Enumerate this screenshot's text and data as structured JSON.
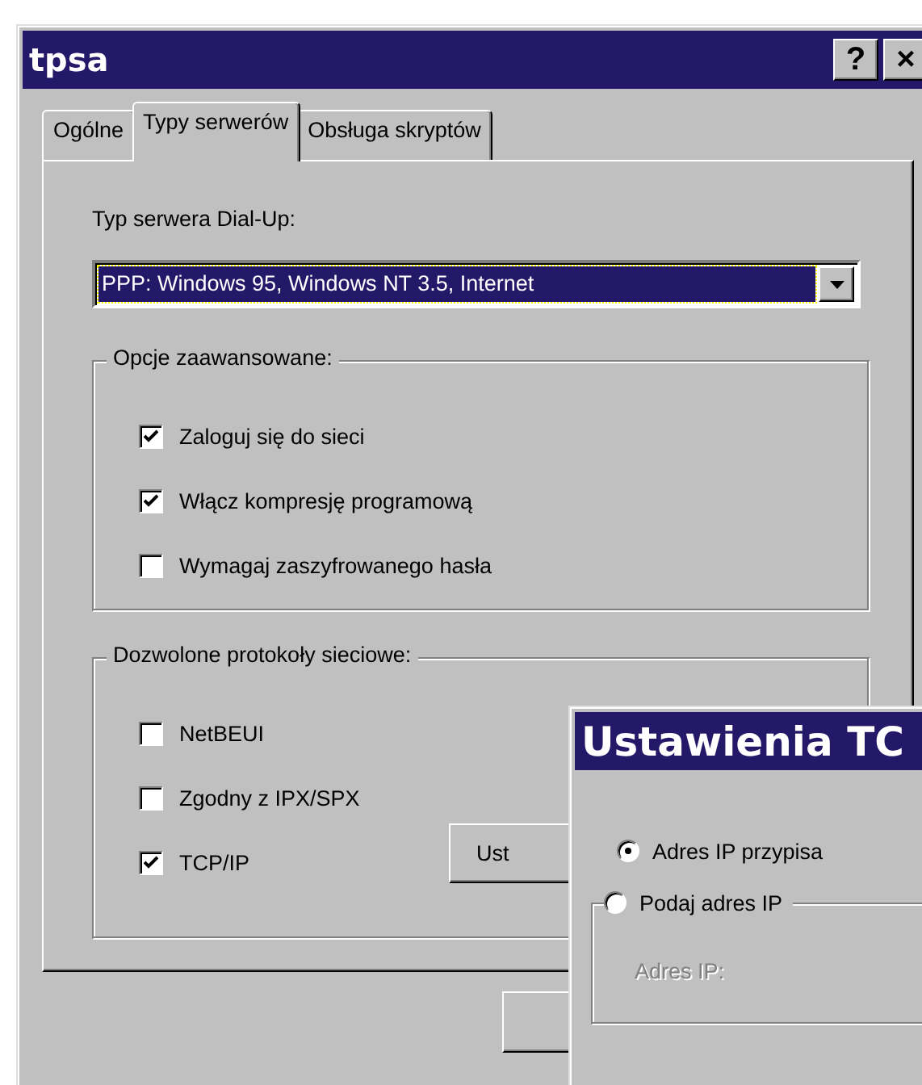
{
  "window": {
    "title": "tpsa",
    "help_button": "?",
    "close_button": "×"
  },
  "tabs": [
    {
      "label": "Ogólne",
      "selected": false
    },
    {
      "label": "Typy serwerów",
      "selected": true
    },
    {
      "label": "Obsługa skryptów",
      "selected": false
    }
  ],
  "server_type": {
    "label": "Typ serwera Dial-Up:",
    "value": "PPP: Windows 95, Windows NT 3.5, Internet"
  },
  "advanced_options": {
    "title": "Opcje zaawansowane:",
    "options": [
      {
        "label": "Zaloguj się do sieci",
        "checked": true
      },
      {
        "label": "Włącz kompresję programową",
        "checked": true
      },
      {
        "label": "Wymagaj zaszyfrowanego hasła",
        "checked": false
      }
    ]
  },
  "protocols": {
    "title": "Dozwolone protokoły sieciowe:",
    "options": [
      {
        "label": "NetBEUI",
        "checked": false
      },
      {
        "label": "Zgodny z IPX/SPX",
        "checked": false
      },
      {
        "label": "TCP/IP",
        "checked": true
      }
    ],
    "settings_button": "Ust"
  },
  "tcp_dialog": {
    "title": "Ustawienia TC",
    "ip_mode": [
      {
        "label": "Adres IP przypisa",
        "selected": true
      },
      {
        "label": "Podaj adres IP",
        "selected": false
      }
    ],
    "ip_address": {
      "label": "Adres IP:",
      "disabled": true
    }
  }
}
